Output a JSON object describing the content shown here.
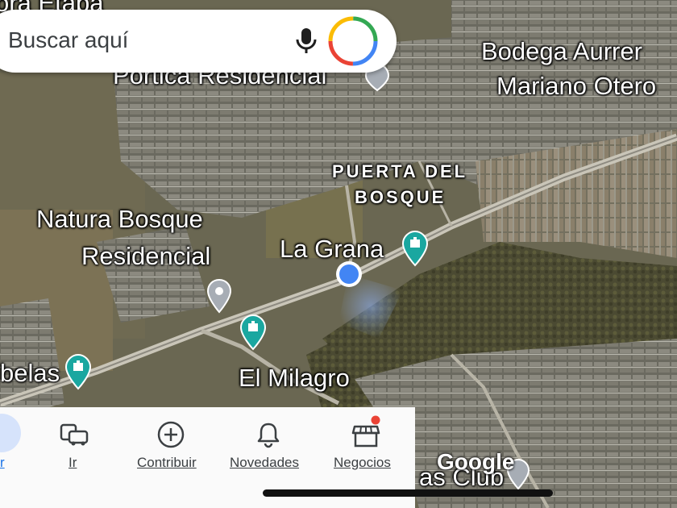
{
  "search": {
    "placeholder": "Buscar aquí"
  },
  "map_labels": {
    "top_left_partial": "ora Etapa",
    "portica": "Portica Residencial",
    "bodega": "Bodega Aurrer",
    "mariano": "Mariano Otero",
    "puerta_line1": "PUERTA DEL",
    "puerta_line2": "BOSQUE",
    "natura_line1": "Natura Bosque",
    "natura_line2": "Residencial",
    "la_grana": "La Grana",
    "el_milagro": "El Milagro",
    "belas": "belas",
    "club": "as Club",
    "google": "Google"
  },
  "nav": {
    "items": [
      {
        "label": "r",
        "icon": "explore-icon"
      },
      {
        "label": "Ir",
        "icon": "car-transit-icon"
      },
      {
        "label": "Contribuir",
        "icon": "add-circle-icon"
      },
      {
        "label": "Novedades",
        "icon": "bell-icon"
      },
      {
        "label": "Negocios",
        "icon": "storefront-icon"
      }
    ]
  },
  "colors": {
    "location_dot": "#4285F4",
    "park_pin": "#1aa7a0",
    "notification_dot": "#ea4335"
  }
}
